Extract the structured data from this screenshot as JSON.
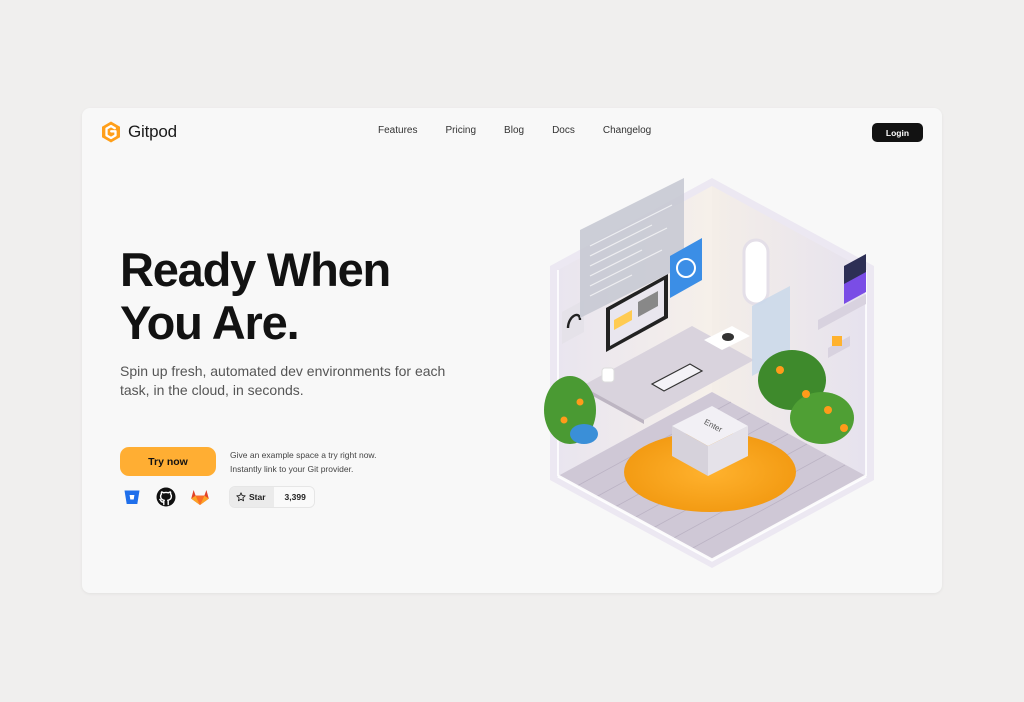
{
  "brand": {
    "name": "Gitpod",
    "accent": "#ffae33"
  },
  "nav": {
    "items": [
      "Features",
      "Pricing",
      "Blog",
      "Docs",
      "Changelog"
    ],
    "login_label": "Login"
  },
  "hero": {
    "title_line1": "Ready When",
    "title_line2": "You Are.",
    "subtitle": "Spin up fresh, automated dev environments for each task, in the cloud, in seconds."
  },
  "cta": {
    "try_label": "Try now",
    "note_line1": "Give an example space a try right now.",
    "note_line2": "Instantly link to your Git provider."
  },
  "providers": [
    "bitbucket-icon",
    "github-icon",
    "gitlab-icon"
  ],
  "github_star": {
    "label": "Star",
    "count": "3,399"
  },
  "illustration": {
    "keycap_label": "Enter"
  }
}
